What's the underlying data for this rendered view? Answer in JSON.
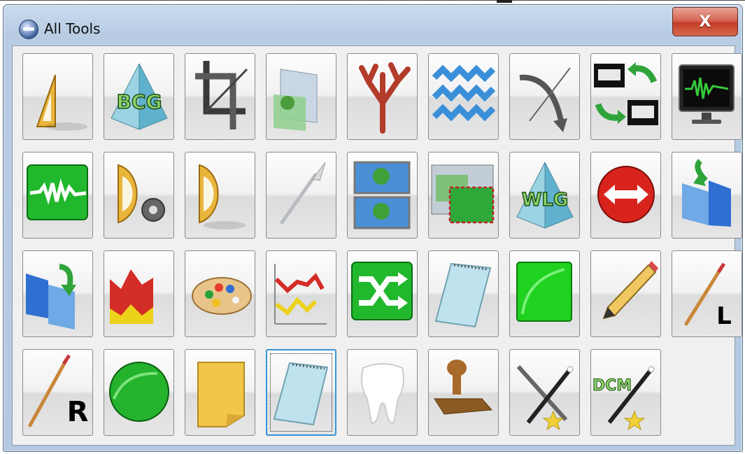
{
  "window": {
    "title": "All Tools",
    "close_label": "X"
  },
  "tiles": [
    {
      "icon": "triangle-ruler-icon"
    },
    {
      "icon": "bcg-pyramid-icon",
      "label": "BCG"
    },
    {
      "icon": "crop-icon"
    },
    {
      "icon": "image-overlay-icon"
    },
    {
      "icon": "coral-icon"
    },
    {
      "icon": "waves-icon"
    },
    {
      "icon": "curved-arrow-icon"
    },
    {
      "icon": "bus-swap-icon"
    },
    {
      "icon": "monitor-waveform-icon"
    },
    {
      "icon": "green-waveform-icon"
    },
    {
      "icon": "protractor-gear-icon"
    },
    {
      "icon": "protractor-icon"
    },
    {
      "icon": "scalpel-icon"
    },
    {
      "icon": "stacked-images-icon"
    },
    {
      "icon": "image-region-icon"
    },
    {
      "icon": "wlg-pyramid-icon",
      "label": "WLG"
    },
    {
      "icon": "red-double-arrow-icon"
    },
    {
      "icon": "blue-undo-icon"
    },
    {
      "icon": "blue-redo-icon"
    },
    {
      "icon": "area-chart-icon"
    },
    {
      "icon": "palette-icon"
    },
    {
      "icon": "line-chart-icon"
    },
    {
      "icon": "shuffle-icon"
    },
    {
      "icon": "notepad-icon"
    },
    {
      "icon": "green-square-icon"
    },
    {
      "icon": "pencil-icon"
    },
    {
      "icon": "brush-l-icon",
      "label": "L"
    },
    {
      "icon": "brush-r-icon",
      "label": "R"
    },
    {
      "icon": "green-circle-icon"
    },
    {
      "icon": "sticky-note-icon"
    },
    {
      "icon": "notepad-selected-icon",
      "selected": true
    },
    {
      "icon": "tooth-icon"
    },
    {
      "icon": "stamp-icon"
    },
    {
      "icon": "magic-tools-icon"
    },
    {
      "icon": "dcm-wand-icon",
      "label": "DCM"
    }
  ]
}
